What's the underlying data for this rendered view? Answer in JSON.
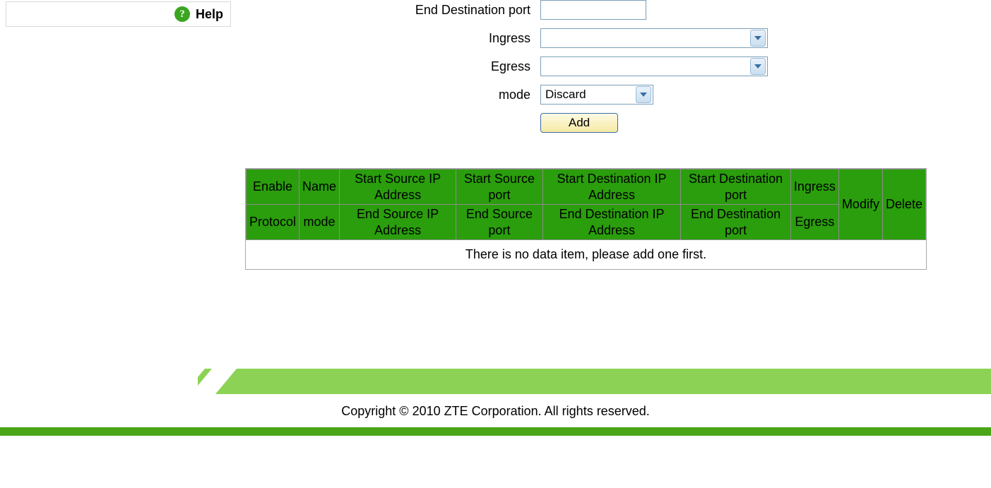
{
  "sidebar": {
    "help_label": "Help",
    "help_icon_glyph": "?"
  },
  "form": {
    "end_dest_port": {
      "label": "End Destination port",
      "value": ""
    },
    "ingress": {
      "label": "Ingress",
      "value": ""
    },
    "egress": {
      "label": "Egress",
      "value": ""
    },
    "mode": {
      "label": "mode",
      "value": "Discard"
    },
    "add_button": "Add"
  },
  "table": {
    "headers_row1": [
      "Enable",
      "Name",
      "Start Source IP Address",
      "Start Source port",
      "Start Destination IP Address",
      "Start Destination port",
      "Ingress"
    ],
    "headers_row2": [
      "Protocol",
      "mode",
      "End Source IP Address",
      "End Source port",
      "End Destination IP Address",
      "End Destination port",
      "Egress"
    ],
    "headers_side": [
      "Modify",
      "Delete"
    ],
    "empty_message": "There is no data item, please add one first."
  },
  "footer": {
    "copyright": "Copyright © 2010 ZTE Corporation. All rights reserved."
  }
}
